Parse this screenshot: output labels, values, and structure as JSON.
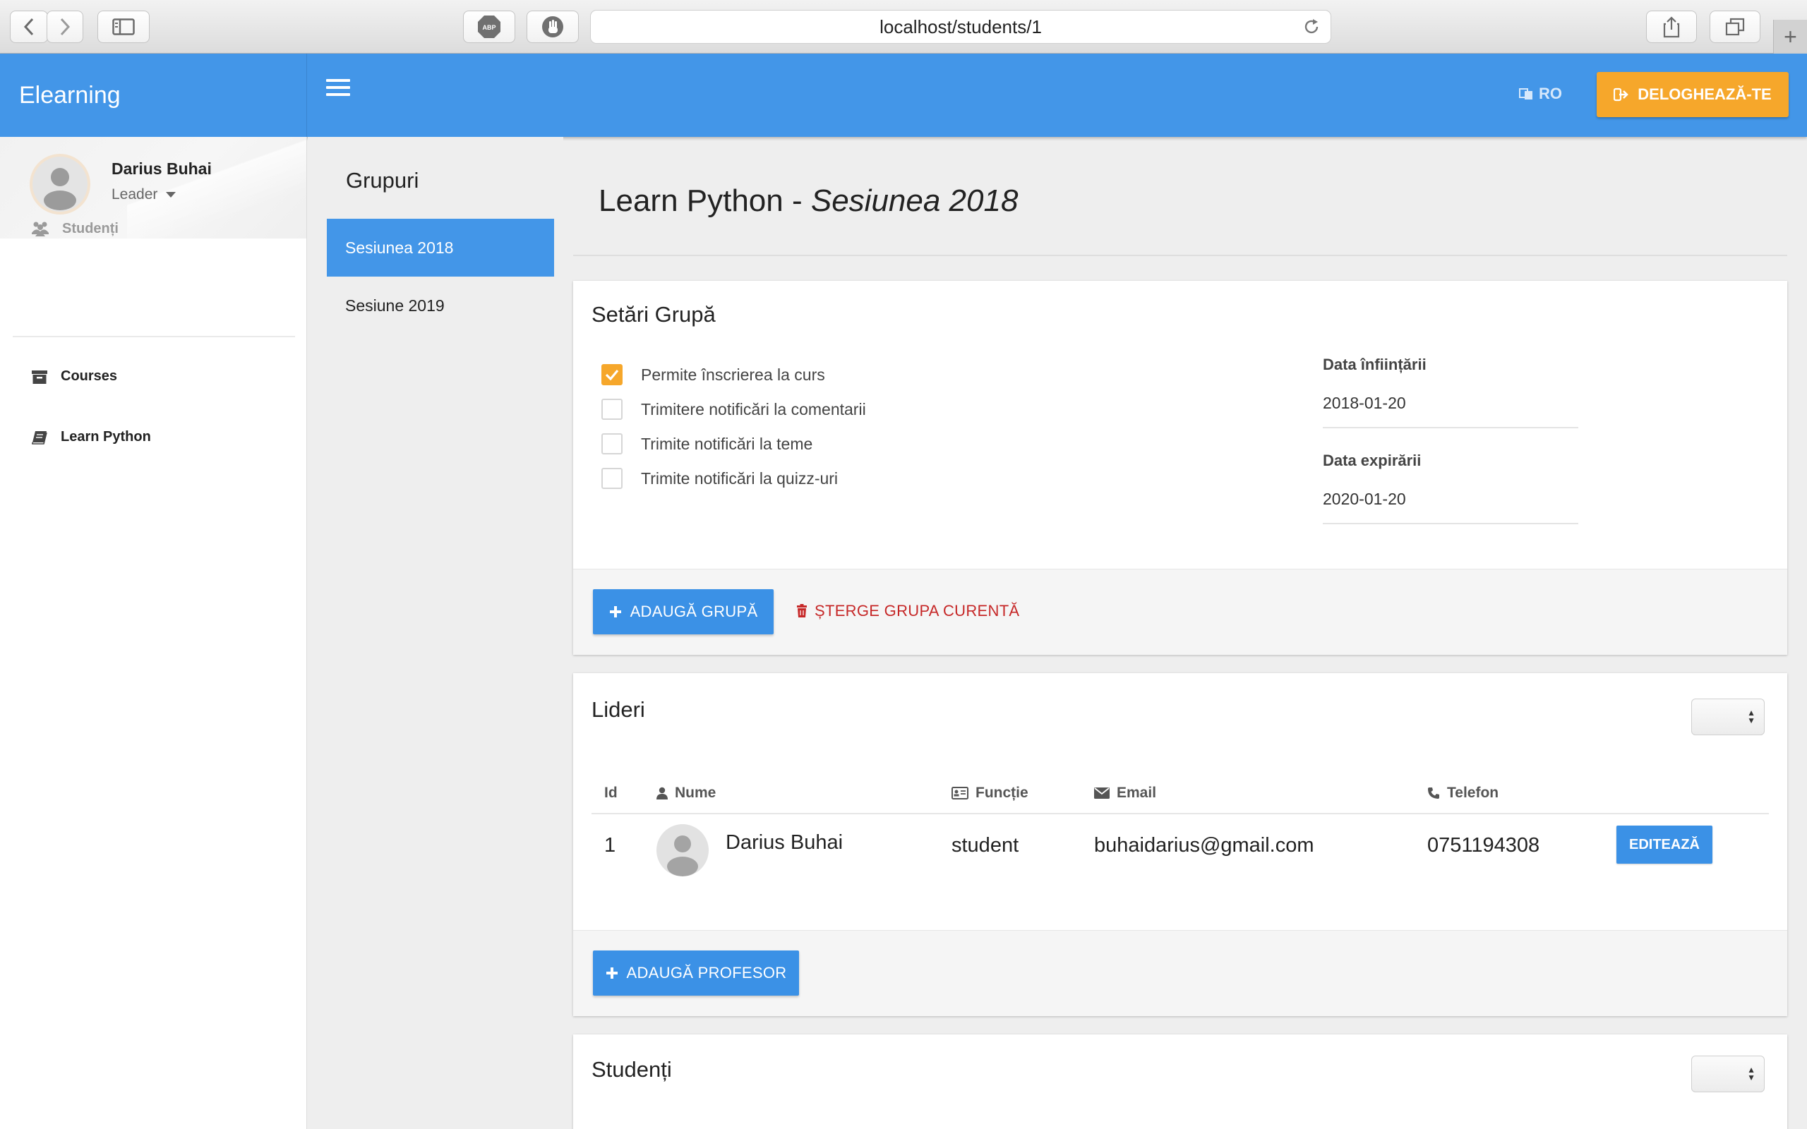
{
  "browser": {
    "url": "localhost/students/1",
    "adblock_label": "ABP"
  },
  "app": {
    "brand": "Elearning",
    "language": "RO",
    "logout_label": "DELOGHEAZĂ-TE"
  },
  "user": {
    "name": "Darius Buhai",
    "role": "Leader"
  },
  "sidebar": {
    "items": [
      {
        "label": "Studenți",
        "icon": "users-icon",
        "muted": true
      },
      {
        "label": "Courses",
        "icon": "archive-icon",
        "muted": false
      },
      {
        "label": "Learn Python",
        "icon": "book-icon",
        "muted": false
      }
    ]
  },
  "groups": {
    "title": "Grupuri",
    "items": [
      {
        "label": "Sesiunea 2018",
        "active": true
      },
      {
        "label": "Sesiune 2019",
        "active": false
      }
    ]
  },
  "page": {
    "title_main": "Learn Python - ",
    "title_session": "Sesiunea 2018"
  },
  "settings": {
    "title": "Setări Grupă",
    "options": [
      {
        "label": "Permite înscrierea la curs",
        "checked": true
      },
      {
        "label": "Trimitere notificări la comentarii",
        "checked": false
      },
      {
        "label": "Trimite notificări la teme",
        "checked": false
      },
      {
        "label": "Trimite notificări la quizz-uri",
        "checked": false
      }
    ],
    "created_label": "Data înființării",
    "created_value": "2018-01-20",
    "expires_label": "Data expirării",
    "expires_value": "2020-01-20",
    "add_group_label": "ADAUGĂ GRUPĂ",
    "delete_group_label": "ȘTERGE GRUPA CURENTĂ"
  },
  "leaders": {
    "title": "Lideri",
    "columns": [
      "Id",
      "Nume",
      "Funcție",
      "Email",
      "Telefon"
    ],
    "rows": [
      {
        "id": "1",
        "name": "Darius Buhai",
        "role": "student",
        "email": "buhaidarius@gmail.com",
        "phone": "0751194308"
      }
    ],
    "edit_label": "EDITEAZĂ",
    "add_teacher_label": "ADAUGĂ PROFESOR"
  },
  "students": {
    "title": "Studenți"
  },
  "colors": {
    "primary": "#4396e8",
    "accent": "#f6a72b",
    "danger": "#c62828"
  }
}
